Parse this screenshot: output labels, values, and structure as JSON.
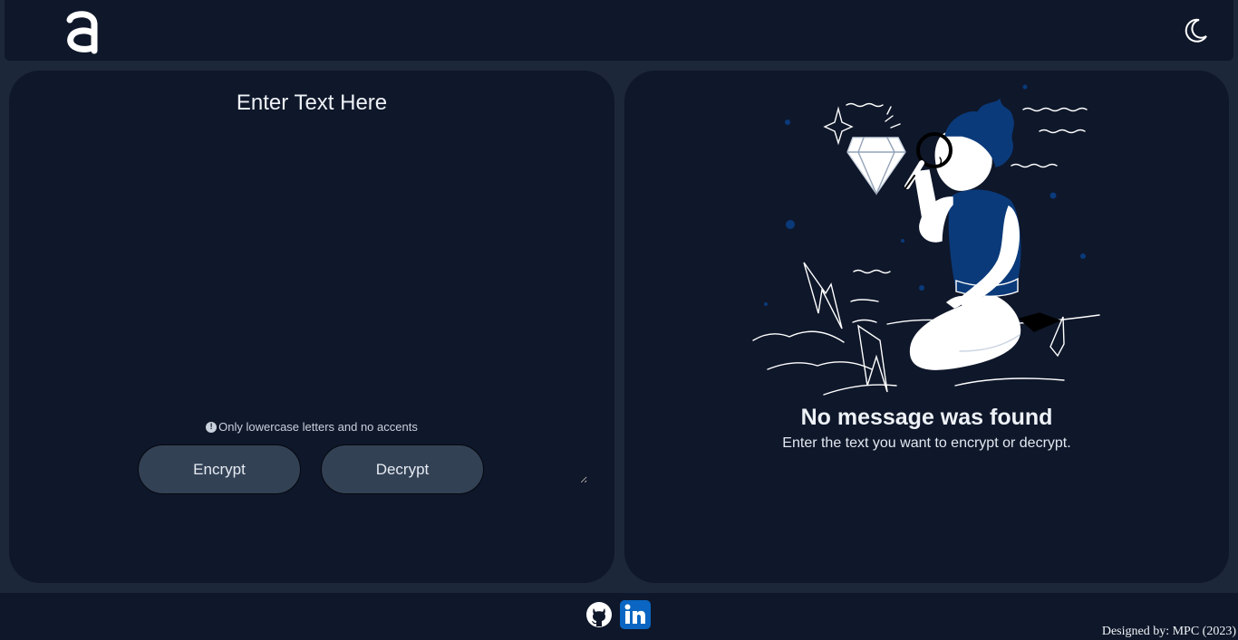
{
  "header": {
    "logo_icon": "alura-a-logo",
    "theme_toggle_icon": "moon-icon"
  },
  "input_panel": {
    "title": "Enter Text Here",
    "textarea_value": "",
    "hint_icon": "info-icon",
    "hint_text": "Only lowercase letters and no accents",
    "encrypt_label": "Encrypt",
    "decrypt_label": "Decrypt"
  },
  "output_panel": {
    "illustration": "person-with-magnifying-glass-examining-diamond",
    "empty_title": "No message was found",
    "empty_subtitle": "Enter the text you want to encrypt or decrypt."
  },
  "footer": {
    "github_icon": "github-icon",
    "linkedin_icon": "linkedin-icon",
    "credit": "Designed by: MPC (2023)"
  },
  "colors": {
    "page_bg": "#1c2739",
    "panel_bg": "#0f172a",
    "button_bg": "#334155",
    "accent_blue": "#0a3a7a",
    "linkedin_blue": "#0a66c2"
  }
}
